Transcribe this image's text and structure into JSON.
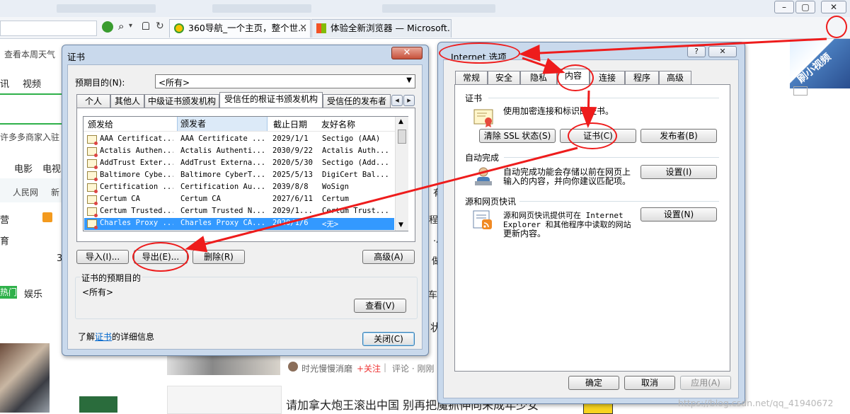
{
  "browser": {
    "tabs": [
      {
        "label": "360导航_一个主页，整个世..."
      },
      {
        "label": "体验全新浏览器 — Microsoft..."
      }
    ],
    "bg_texts": {
      "weather": "查看本周天气",
      "nav_video": "视频",
      "nav_xun": "讯",
      "merchants": "许多多商家入驻",
      "movie": "电影",
      "tv": "电视",
      "renminwang": "人民网",
      "xin": "新",
      "ying": "营",
      "yu": "育",
      "num3": "3",
      "hot": "热门",
      "yule": "娱乐",
      "che": "车",
      "zhuang": "状：",
      "author": "时光慢慢消磨",
      "follow": "+关注",
      "sep": "|",
      "comment": "评论 · 刚刚",
      "headline": "请加拿大炮王滚出中国 别再把魔抓伸向未成年少女",
      "watermark": "https://blog.csdn.net/qq_41940672",
      "cheng": "程航",
      "xiao": "·小",
      "zuo": "做",
      "you": "有",
      "badge": "刷小视频"
    }
  },
  "cert_dialog": {
    "title": "证书",
    "close": "✕",
    "purpose_label": "预期目的(N):",
    "purpose_value": "<所有>",
    "tabs": [
      "个人",
      "其他人",
      "中级证书颁发机构",
      "受信任的根证书颁发机构",
      "受信任的发布者"
    ],
    "columns": [
      "颁发给",
      "颁发者",
      "截止日期",
      "友好名称"
    ],
    "rows": [
      {
        "to": "AAA Certificat...",
        "by": "AAA Certificate ...",
        "date": "2029/1/1",
        "name": "Sectigo (AAA)"
      },
      {
        "to": "Actalis Authen...",
        "by": "Actalis Authenti...",
        "date": "2030/9/22",
        "name": "Actalis Auth..."
      },
      {
        "to": "AddTrust Exter...",
        "by": "AddTrust Externa...",
        "date": "2020/5/30",
        "name": "Sectigo (Add..."
      },
      {
        "to": "Baltimore Cybe...",
        "by": "Baltimore CyberT...",
        "date": "2025/5/13",
        "name": "DigiCert Bal..."
      },
      {
        "to": "Certification ...",
        "by": "Certification Au...",
        "date": "2039/8/8",
        "name": "WoSign"
      },
      {
        "to": "Certum CA",
        "by": "Certum CA",
        "date": "2027/6/11",
        "name": "Certum"
      },
      {
        "to": "Certum Trusted...",
        "by": "Certum Trusted N...",
        "date": "2029/1...",
        "name": "Certum Trust..."
      },
      {
        "to": "Charles Proxy ...",
        "by": "Charles Proxy CA...",
        "date": "2020/1/6",
        "name": "<无>"
      }
    ],
    "btn_import": "导入(I)...",
    "btn_export": "导出(E)...",
    "btn_delete": "删除(R)",
    "btn_advanced": "高级(A)",
    "group_title": "证书的预期目的",
    "group_value": "<所有>",
    "btn_view": "查看(V)",
    "learn_prefix": "了解",
    "learn_link": "证书",
    "learn_suffix": "的详细信息",
    "btn_close": "关闭(C)"
  },
  "ie_dialog": {
    "title": "Internet 选项",
    "help": "?",
    "close": "✕",
    "tabs": [
      "常规",
      "安全",
      "隐私",
      "内容",
      "连接",
      "程序",
      "高级"
    ],
    "cert_group": "证书",
    "cert_desc": "使用加密连接和标识的证书。",
    "btn_clear_ssl": "清除 SSL 状态(S)",
    "btn_certs": "证书(C)",
    "btn_publishers": "发布者(B)",
    "ac_group": "自动完成",
    "ac_desc_1": "自动完成功能会存储以前在网页上",
    "ac_desc_2": "输入的内容，并向你建议匹配项。",
    "btn_ac_settings": "设置(I)",
    "feed_group": "源和网页快讯",
    "feed_desc_1": "源和网页快讯提供可在 Internet",
    "feed_desc_2": "Explorer 和其他程序中读取的网站",
    "feed_desc_3": "更新内容。",
    "btn_feed_settings": "设置(N)",
    "btn_ok": "确定",
    "btn_cancel": "取消",
    "btn_apply": "应用(A)"
  },
  "colors": {
    "annotation": "#ee1c1c",
    "selection": "#3399ff",
    "dialog_frame": "#c9d9ec",
    "link": "#0066cc"
  }
}
